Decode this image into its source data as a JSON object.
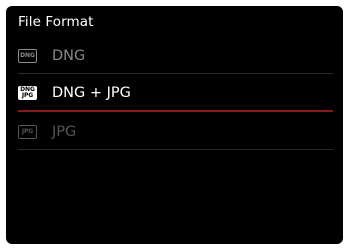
{
  "menu": {
    "title": "File Format",
    "options": [
      {
        "icon_text": "DNG",
        "label": "DNG",
        "state": "inactive"
      },
      {
        "icon_text_top": "DNG",
        "icon_text_bottom": "JPG",
        "label": "DNG + JPG",
        "state": "selected"
      },
      {
        "icon_text": "JPG",
        "label": "JPG",
        "state": "disabled"
      }
    ]
  },
  "colors": {
    "background": "#000000",
    "text_selected": "#ffffff",
    "text_inactive": "#8a8a8a",
    "text_disabled": "#555555",
    "accent_line": "#8a1a1a"
  },
  "icons": [
    "dng-format-icon",
    "dng-jpg-format-icon",
    "jpg-format-icon"
  ]
}
